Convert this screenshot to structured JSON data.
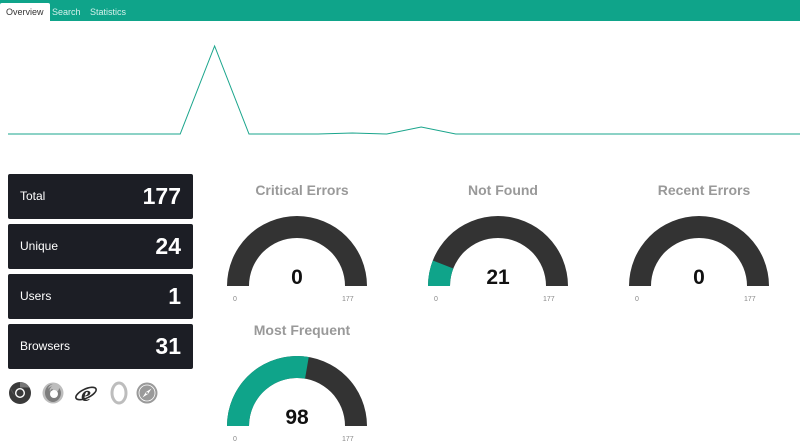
{
  "nav": {
    "tabs": [
      {
        "label": "Overview",
        "active": true
      },
      {
        "label": "Search",
        "active": false
      },
      {
        "label": "Statistics",
        "active": false
      }
    ],
    "color": "#0fa48a"
  },
  "sparkline": {
    "color": "#1aa58c",
    "values": [
      0,
      0,
      0,
      0,
      0,
      0,
      88,
      0,
      0,
      0,
      1,
      0,
      7,
      0,
      0,
      0,
      0,
      0,
      0,
      0,
      0,
      0,
      0,
      0
    ]
  },
  "stats": [
    {
      "label": "Total",
      "value": "177"
    },
    {
      "label": "Unique",
      "value": "24"
    },
    {
      "label": "Users",
      "value": "1"
    },
    {
      "label": "Browsers",
      "value": "31"
    }
  ],
  "browsers": [
    "chrome-icon",
    "firefox-icon",
    "internet-explorer-icon",
    "opera-icon",
    "safari-icon"
  ],
  "gauges": [
    {
      "title": "Critical Errors",
      "value": "0",
      "min": "0",
      "max": "177",
      "fraction": 0
    },
    {
      "title": "Not Found",
      "value": "21",
      "min": "0",
      "max": "177",
      "fraction": 0.1186
    },
    {
      "title": "Recent Errors",
      "value": "0",
      "min": "0",
      "max": "177",
      "fraction": 0
    },
    {
      "title": "Most Frequent",
      "value": "98",
      "min": "0",
      "max": "177",
      "fraction": 0.5537
    }
  ],
  "gauge_colors": {
    "track": "#333333",
    "fill": "#0fa48a"
  }
}
